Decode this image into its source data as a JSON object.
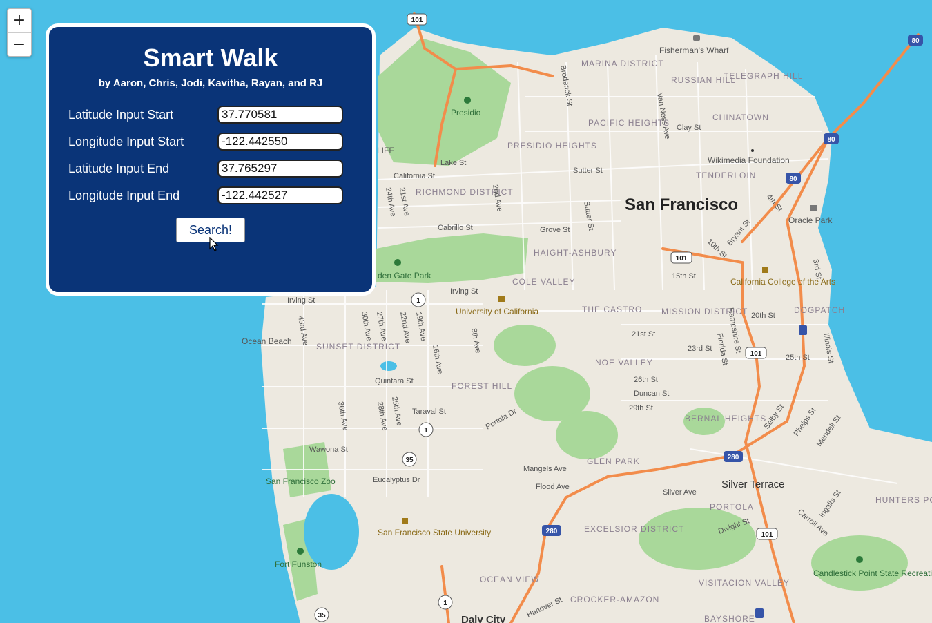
{
  "app": {
    "title": "Smart Walk",
    "subtitle": "by Aaron, Chris, Jodi, Kavitha, Rayan, and RJ"
  },
  "zoom": {
    "in_label": "+",
    "out_label": "−"
  },
  "form": {
    "lat_start_label": "Latitude Input Start",
    "lat_start_value": "37.770581",
    "lng_start_label": "Longitude Input Start",
    "lng_start_value": "-122.442550",
    "lat_end_label": "Latitude Input End",
    "lat_end_value": "37.765297",
    "lng_end_label": "Longitude Input End",
    "lng_end_value": "-122.442527",
    "search_label": "Search!"
  },
  "map": {
    "city_label": "San Francisco",
    "neighborhoods": [
      "MARINA DISTRICT",
      "RUSSIAN HILL",
      "TELEGRAPH HILL",
      "PACIFIC HEIGHTS",
      "CHINATOWN",
      "PRESIDIO HEIGHTS",
      "TENDERLOIN",
      "RICHMOND DISTRICT",
      "HAIGHT-ASHBURY",
      "COLE VALLEY",
      "THE CASTRO",
      "MISSION DISTRICT",
      "DOGPATCH",
      "SUNSET DISTRICT",
      "NOE VALLEY",
      "FOREST HILL",
      "BERNAL HEIGHTS",
      "GLEN PARK",
      "PORTOLA",
      "EXCELSIOR DISTRICT",
      "OCEAN VIEW",
      "CROCKER-AMAZON",
      "VISITACION VALLEY",
      "HUNTERS POINT",
      "BAYSHORE"
    ],
    "streets": [
      "Broderick St",
      "Van Ness Ave",
      "Clay St",
      "California St",
      "Lake St",
      "Sutter St",
      "Cabrillo St",
      "Grove St",
      "Irving St",
      "Quintara St",
      "Taraval St",
      "Wawona St",
      "Eucalyptus Dr",
      "Portola Dr",
      "Mangels Ave",
      "Flood Ave",
      "Silver Ave",
      "Dwight St",
      "26th St",
      "Duncan St",
      "29th St",
      "21st St",
      "23rd St",
      "20th St",
      "25th St",
      "15th St",
      "10th St",
      "Bryant St",
      "4th St",
      "3rd St",
      "Illinois St",
      "Hampshire St",
      "Florida St",
      "Selby St",
      "Phelps St",
      "Mendell St",
      "Ingalls St",
      "Carroll Ave",
      "43rd Ave",
      "30th Ave",
      "27th Ave",
      "22nd Ave",
      "19th Ave",
      "16th Ave",
      "8th Ave",
      "36th Ave",
      "28th Ave",
      "25th Ave",
      "24th Ave",
      "21st Ave",
      "2nd Ave",
      "Hanover St",
      "Daly City"
    ],
    "places": [
      "Presidio",
      "Fisherman's Wharf",
      "Wikimedia Foundation",
      "Oracle Park",
      "California College of the Arts",
      "University of California",
      "den Gate Park",
      "Ocean Beach",
      "San Francisco Zoo",
      "San Francisco State University",
      "Fort Funston",
      "Silver Terrace",
      "Candlestick Point State Recreational Area",
      "LIFF"
    ],
    "highway_shields": [
      "101",
      "80",
      "1",
      "35",
      "280"
    ],
    "colors": {
      "water": "#4bbfe6",
      "land": "#ede9e0",
      "park": "#a9d89a",
      "highway": "#f28c4b",
      "panel": "#0a3478"
    }
  }
}
